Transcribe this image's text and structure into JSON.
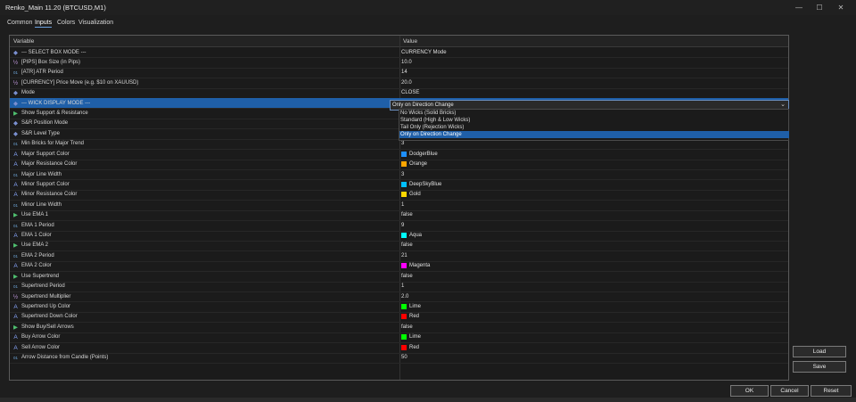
{
  "window": {
    "title": "Renko_Main 11.20 (BTCUSD,M1)",
    "minimize": "—",
    "maximize": "☐",
    "close": "✕"
  },
  "tabs": [
    "Common",
    "Inputs",
    "Colors",
    "Visualization"
  ],
  "grid": {
    "col_variable": "Variable",
    "col_value": "Value",
    "rows": [
      {
        "icon": "diamond",
        "name": "--- SELECT BOX MODE ---",
        "value": "CURRENCY Mode"
      },
      {
        "icon": "half",
        "name": "[PIPS] Box Size (in Pips)",
        "value": "10.0"
      },
      {
        "icon": "int",
        "name": "[ATR] ATR Period",
        "value": "14"
      },
      {
        "icon": "half",
        "name": "[CURRENCY] Price Move (e.g. $10 on XAUUSD)",
        "value": "20.0"
      },
      {
        "icon": "diamond",
        "name": "Mode",
        "value": "CLOSE"
      },
      {
        "icon": "diamond",
        "name": "--- WICK DISPLAY MODE ---",
        "value": ""
      },
      {
        "icon": "bool",
        "name": "Show Support & Resistance",
        "value": ""
      },
      {
        "icon": "diamond",
        "name": "S&R Position Mode",
        "value": ""
      },
      {
        "icon": "diamond",
        "name": "S&R Level Type",
        "value": ""
      },
      {
        "icon": "int",
        "name": "Min Bricks for Major Trend",
        "value": "3"
      },
      {
        "icon": "color",
        "name": "Major Support Color",
        "value": "DodgerBlue",
        "swatch": "#1e90ff"
      },
      {
        "icon": "color",
        "name": "Major Resistance Color",
        "value": "Orange",
        "swatch": "#ffa500"
      },
      {
        "icon": "int",
        "name": "Major Line Width",
        "value": "3"
      },
      {
        "icon": "color",
        "name": "Minor Support Color",
        "value": "DeepSkyBlue",
        "swatch": "#00bfff"
      },
      {
        "icon": "color",
        "name": "Minor Resistance Color",
        "value": "Gold",
        "swatch": "#ffd700"
      },
      {
        "icon": "int",
        "name": "Minor Line Width",
        "value": "1"
      },
      {
        "icon": "bool",
        "name": "Use EMA 1",
        "value": "false"
      },
      {
        "icon": "int",
        "name": "EMA 1 Period",
        "value": "9"
      },
      {
        "icon": "color",
        "name": "EMA 1 Color",
        "value": "Aqua",
        "swatch": "#00ffff"
      },
      {
        "icon": "bool",
        "name": "Use EMA 2",
        "value": "false"
      },
      {
        "icon": "int",
        "name": "EMA 2 Period",
        "value": "21"
      },
      {
        "icon": "color",
        "name": "EMA 2 Color",
        "value": "Magenta",
        "swatch": "#ff00ff"
      },
      {
        "icon": "bool",
        "name": "Use Supertrend",
        "value": "false"
      },
      {
        "icon": "int",
        "name": "Supertrend Period",
        "value": "1"
      },
      {
        "icon": "half",
        "name": "Supertrend Multiplier",
        "value": "2.0"
      },
      {
        "icon": "color",
        "name": "Supertrend Up Color",
        "value": "Lime",
        "swatch": "#00ff00"
      },
      {
        "icon": "color",
        "name": "Supertrend Down Color",
        "value": "Red",
        "swatch": "#ff0000"
      },
      {
        "icon": "bool",
        "name": "Show Buy/Sell Arrows",
        "value": "false"
      },
      {
        "icon": "color",
        "name": "Buy Arrow Color",
        "value": "Lime",
        "swatch": "#00ff00"
      },
      {
        "icon": "color",
        "name": "Sell Arrow Color",
        "value": "Red",
        "swatch": "#ff0000"
      },
      {
        "icon": "int",
        "name": "Arrow Distance from Candle (Points)",
        "value": "50"
      }
    ],
    "selected_row_index": 5
  },
  "wick_select": {
    "value": "Only on Direction Change",
    "chevron": "⌄",
    "options": [
      "No Wicks (Solid Bricks)",
      "Standard (High & Low Wicks)",
      "Tail Only (Rejection Wicks)",
      "Only on Direction Change"
    ],
    "selected_option_index": 3
  },
  "side_buttons": {
    "load": "Load",
    "save": "Save"
  },
  "footer_buttons": {
    "ok": "OK",
    "cancel": "Cancel",
    "reset": "Reset"
  },
  "colors": {
    "accent": "#1f5fa8",
    "background": "#1e1e1e"
  }
}
